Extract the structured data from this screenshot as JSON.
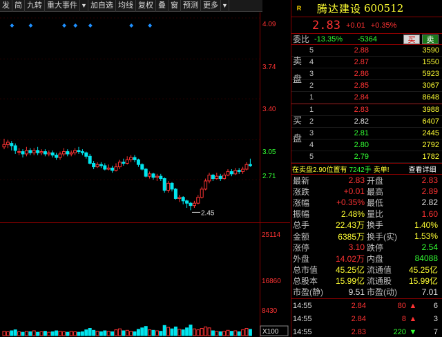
{
  "toolbar": {
    "items": [
      "发",
      "简",
      "九转",
      "重大事件",
      "加自选",
      "均线",
      "复权",
      "叠",
      "窗",
      "预测",
      "更多"
    ]
  },
  "stock": {
    "badge": "R",
    "name": "腾达建设",
    "code": "600512",
    "price": "2.83",
    "change": "+0.01",
    "change_pct": "+0.35%"
  },
  "weibi": {
    "label": "委比",
    "ratio": "-13.35%",
    "diff": "-5364",
    "buy_label": "买",
    "sell_label": "卖"
  },
  "sell_book": {
    "label_1": "卖",
    "label_2": "盘",
    "rows": [
      {
        "level": "5",
        "price": "2.88",
        "vol": "3590",
        "color": "up"
      },
      {
        "level": "4",
        "price": "2.87",
        "vol": "1550",
        "color": "up"
      },
      {
        "level": "3",
        "price": "2.86",
        "vol": "5923",
        "color": "up"
      },
      {
        "level": "2",
        "price": "2.85",
        "vol": "3067",
        "color": "up"
      },
      {
        "level": "1",
        "price": "2.84",
        "vol": "8648",
        "color": "up"
      }
    ]
  },
  "buy_book": {
    "label_1": "买",
    "label_2": "盘",
    "rows": [
      {
        "level": "1",
        "price": "2.83",
        "vol": "3988",
        "color": "up"
      },
      {
        "level": "2",
        "price": "2.82",
        "vol": "6407",
        "color": "eq"
      },
      {
        "level": "3",
        "price": "2.81",
        "vol": "2445",
        "color": "dn"
      },
      {
        "level": "4",
        "price": "2.80",
        "vol": "2792",
        "color": "dn"
      },
      {
        "level": "5",
        "price": "2.79",
        "vol": "1782",
        "color": "dn"
      }
    ]
  },
  "big_order": {
    "text": "在卖盘2.90位置有",
    "qty": "7242手",
    "kind": "卖单!",
    "detail_label": "查看详细"
  },
  "stats": [
    {
      "k1": "最新",
      "v1": "2.83",
      "c1": "up",
      "k2": "开盘",
      "v2": "2.83",
      "c2": "up"
    },
    {
      "k1": "涨跌",
      "v1": "+0.01",
      "c1": "up",
      "k2": "最高",
      "v2": "2.89",
      "c2": "up"
    },
    {
      "k1": "涨幅",
      "v1": "+0.35%",
      "c1": "up",
      "k2": "最低",
      "v2": "2.82",
      "c2": "wht"
    },
    {
      "k1": "振幅",
      "v1": "2.48%",
      "c1": "yel",
      "k2": "量比",
      "v2": "1.60",
      "c2": "up"
    },
    {
      "k1": "总手",
      "v1": "22.43万",
      "c1": "yel",
      "k2": "换手",
      "v2": "1.40%",
      "c2": "yel"
    },
    {
      "k1": "金额",
      "v1": "6385万",
      "c1": "yel",
      "k2": "换手(实)",
      "v2": "1.53%",
      "c2": "yel"
    },
    {
      "k1": "涨停",
      "v1": "3.10",
      "c1": "up",
      "k2": "跌停",
      "v2": "2.54",
      "c2": "dn"
    },
    {
      "k1": "外盘",
      "v1": "14.02万",
      "c1": "up",
      "k2": "内盘",
      "v2": "84088",
      "c2": "dn"
    },
    {
      "k1": "总市值",
      "v1": "45.25亿",
      "c1": "yel",
      "k2": "流通值",
      "v2": "45.25亿",
      "c2": "yel"
    },
    {
      "k1": "总股本",
      "v1": "15.99亿",
      "c1": "yel",
      "k2": "流通股",
      "v2": "15.99亿",
      "c2": "yel"
    },
    {
      "k1": "市盈(静)",
      "v1": "9.51",
      "c1": "wht",
      "k2": "市盈(动)",
      "v2": "7.01",
      "c2": "wht"
    }
  ],
  "trades": [
    {
      "time": "14:55",
      "price": "2.84",
      "pcolor": "up",
      "vol": "80",
      "vcolor": "up",
      "dir": "up",
      "num": "6"
    },
    {
      "time": "14:55",
      "price": "2.84",
      "pcolor": "up",
      "vol": "8",
      "vcolor": "up",
      "dir": "up",
      "num": "3"
    },
    {
      "time": "14:55",
      "price": "2.83",
      "pcolor": "up",
      "vol": "220",
      "vcolor": "dn",
      "dir": "dn",
      "num": "7"
    }
  ],
  "chart_data": {
    "type": "candlestick",
    "price_axis": [
      "4.09",
      "3.74",
      "3.40",
      "3.05",
      "2.71"
    ],
    "volume_axis": [
      "25114",
      "16860",
      "8430"
    ],
    "volume_unit": "X100",
    "low_annotation": "2.45",
    "ylim": [
      2.37,
      4.09
    ],
    "candles": [
      [
        2.99,
        3.01,
        3.06,
        2.97
      ],
      [
        3.01,
        3.03,
        3.05,
        2.98
      ],
      [
        3.02,
        3.0,
        3.04,
        2.96
      ],
      [
        3.0,
        2.96,
        3.02,
        2.93
      ],
      [
        2.95,
        2.95,
        2.98,
        2.92
      ],
      [
        2.95,
        2.93,
        2.97,
        2.9
      ],
      [
        2.93,
        2.96,
        2.99,
        2.91
      ],
      [
        2.96,
        2.94,
        2.98,
        2.92
      ],
      [
        2.94,
        2.96,
        2.98,
        2.92
      ],
      [
        2.96,
        2.94,
        2.99,
        2.92
      ],
      [
        2.94,
        2.95,
        2.97,
        2.92
      ],
      [
        2.95,
        2.93,
        2.97,
        2.91
      ],
      [
        2.93,
        2.94,
        2.96,
        2.91
      ],
      [
        2.94,
        2.92,
        2.96,
        2.9
      ],
      [
        2.92,
        2.9,
        2.94,
        2.88
      ],
      [
        2.9,
        2.93,
        2.95,
        2.88
      ],
      [
        2.93,
        2.95,
        2.98,
        2.91
      ],
      [
        2.95,
        2.93,
        2.97,
        2.91
      ],
      [
        2.93,
        2.94,
        2.96,
        2.91
      ],
      [
        2.94,
        2.96,
        2.98,
        2.92
      ],
      [
        2.96,
        2.95,
        2.99,
        2.93
      ],
      [
        2.95,
        2.94,
        2.97,
        2.92
      ],
      [
        2.94,
        2.91,
        2.95,
        2.89
      ],
      [
        2.91,
        2.85,
        2.93,
        2.84
      ],
      [
        2.85,
        2.82,
        2.87,
        2.8
      ],
      [
        2.82,
        2.84,
        2.86,
        2.81
      ],
      [
        2.84,
        2.83,
        2.86,
        2.81
      ],
      [
        2.83,
        2.8,
        2.85,
        2.79
      ],
      [
        2.8,
        2.81,
        2.84,
        2.79
      ],
      [
        2.81,
        2.79,
        2.83,
        2.77
      ],
      [
        2.79,
        2.82,
        2.85,
        2.78
      ],
      [
        2.82,
        2.86,
        2.88,
        2.8
      ],
      [
        2.86,
        2.85,
        2.89,
        2.83
      ],
      [
        2.85,
        2.88,
        2.91,
        2.84
      ],
      [
        2.88,
        2.9,
        2.92,
        2.86
      ],
      [
        2.9,
        2.88,
        2.92,
        2.86
      ],
      [
        2.88,
        2.84,
        2.89,
        2.82
      ],
      [
        2.84,
        2.8,
        2.85,
        2.79
      ],
      [
        2.8,
        2.74,
        2.81,
        2.73
      ],
      [
        2.74,
        2.76,
        2.78,
        2.72
      ],
      [
        2.76,
        2.73,
        2.77,
        2.71
      ],
      [
        2.73,
        2.74,
        2.76,
        2.7
      ],
      [
        2.74,
        2.72,
        2.76,
        2.7
      ],
      [
        2.72,
        2.62,
        2.73,
        2.6
      ],
      [
        2.62,
        2.68,
        2.7,
        2.6
      ],
      [
        2.68,
        2.63,
        2.69,
        2.61
      ],
      [
        2.63,
        2.55,
        2.64,
        2.54
      ],
      [
        2.55,
        2.56,
        2.58,
        2.52
      ],
      [
        2.56,
        2.53,
        2.57,
        2.5
      ],
      [
        2.53,
        2.51,
        2.54,
        2.47
      ],
      [
        2.51,
        2.49,
        2.52,
        2.45
      ],
      [
        2.49,
        2.51,
        2.53,
        2.47
      ],
      [
        2.51,
        2.56,
        2.58,
        2.5
      ],
      [
        2.56,
        2.63,
        2.65,
        2.55
      ],
      [
        2.63,
        2.7,
        2.72,
        2.62
      ],
      [
        2.7,
        2.75,
        2.77,
        2.68
      ],
      [
        2.75,
        2.72,
        2.76,
        2.7
      ],
      [
        2.72,
        2.74,
        2.77,
        2.71
      ],
      [
        2.74,
        2.72,
        2.76,
        2.7
      ],
      [
        2.72,
        2.75,
        2.77,
        2.71
      ],
      [
        2.75,
        2.78,
        2.8,
        2.74
      ],
      [
        2.78,
        2.76,
        2.8,
        2.74
      ],
      [
        2.76,
        2.79,
        2.81,
        2.75
      ],
      [
        2.79,
        2.78,
        2.81,
        2.76
      ],
      [
        2.78,
        2.8,
        2.82,
        2.76
      ],
      [
        2.8,
        2.84,
        2.86,
        2.79
      ],
      [
        2.84,
        2.83,
        2.89,
        2.82
      ]
    ],
    "volumes": [
      9,
      8,
      10,
      12,
      8,
      7,
      9,
      8,
      10,
      7,
      8,
      9,
      7,
      8,
      10,
      9,
      8,
      7,
      9,
      8,
      7,
      8,
      12,
      15,
      11,
      9,
      8,
      10,
      9,
      8,
      12,
      14,
      10,
      11,
      9,
      8,
      13,
      16,
      19,
      12,
      11,
      10,
      9,
      21,
      17,
      14,
      18,
      13,
      12,
      16,
      22,
      14,
      12,
      15,
      18,
      16,
      10,
      9,
      8,
      9,
      11,
      9,
      10,
      8,
      12,
      15,
      13
    ],
    "signal_indices": [
      1,
      6,
      15,
      18,
      22,
      33,
      38
    ]
  }
}
